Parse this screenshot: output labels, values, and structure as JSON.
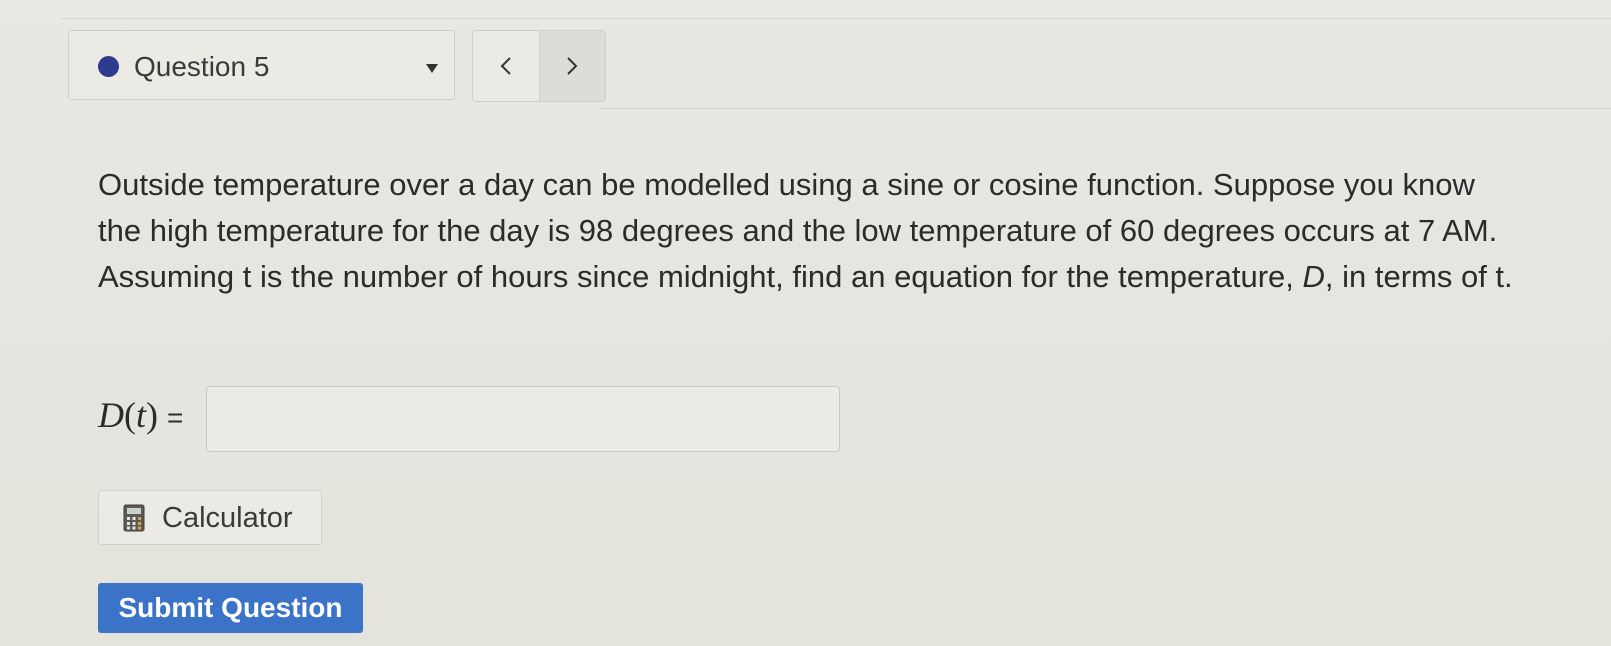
{
  "header": {
    "question_selector": {
      "label": "Question 5",
      "status_color": "#2e3a8c",
      "caret_icon": "caret-down-icon"
    },
    "nav": {
      "prev_icon": "chevron-left-icon",
      "next_icon": "chevron-right-icon"
    }
  },
  "question": {
    "text_before": "Outside temperature over a day can be modelled using a sine or cosine function. Suppose you know the high temperature for the day is 98 degrees and the low temperature of 60 degrees occurs at 7 AM. Assuming t is the number of hours since midnight, find an equation for the temperature, ",
    "variable": "D",
    "text_after": ", in terms of t."
  },
  "answer": {
    "func_name": "D",
    "arg": "t",
    "equals": "=",
    "value": ""
  },
  "tools": {
    "calculator_label": "Calculator",
    "calculator_icon": "calculator-icon"
  },
  "actions": {
    "submit_label": "Submit Question",
    "submit_color": "#3b73c8"
  }
}
